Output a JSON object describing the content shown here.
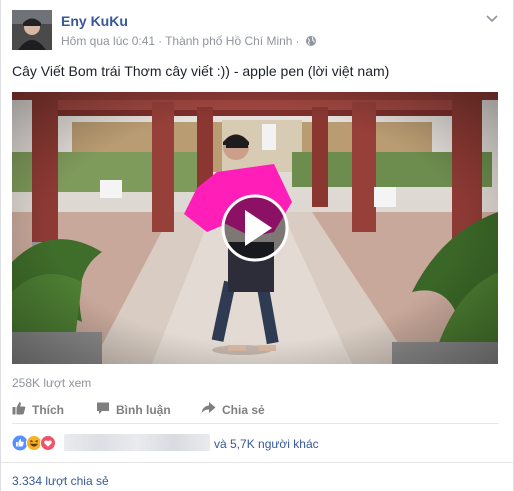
{
  "post": {
    "author": "Eny KuKu",
    "timestamp": "Hôm qua lúc 0:41",
    "separator": "·",
    "location": "Thành phố Hồ Chí Minh",
    "privacy_icon": "globe-icon",
    "text": "Cây Viết Bom trái Thơm cây viết :)) - apple pen (lời việt nam)"
  },
  "video": {
    "play_icon": "play-icon",
    "views": "258K lượt xem"
  },
  "actions": {
    "like": "Thích",
    "comment": "Bình luận",
    "share": "Chia sẻ"
  },
  "reactions": {
    "icons": [
      "like-reaction-icon",
      "haha-reaction-icon",
      "love-reaction-icon"
    ],
    "others": "và 5,7K người khác"
  },
  "shares": "3.334 lượt chia sẻ",
  "colors": {
    "link": "#365899",
    "meta": "#90949c",
    "action": "#7f7f7f",
    "like": "#5890ff",
    "love": "#f25268",
    "haha": "#f7b125"
  }
}
